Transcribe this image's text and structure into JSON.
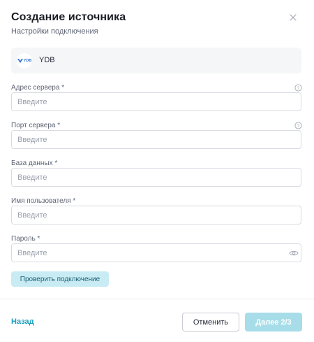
{
  "header": {
    "title": "Создание источника",
    "subtitle": "Настройки подключения",
    "close_icon": "close-icon"
  },
  "source": {
    "logo_text": "YDB",
    "name": "YDB"
  },
  "fields": [
    {
      "label": "Адрес сервера *",
      "placeholder": "Введите",
      "value": "",
      "has_help": true,
      "help_icon": "question-circle-icon"
    },
    {
      "label": "Порт сервера *",
      "placeholder": "Введите",
      "value": "",
      "has_help": true,
      "help_icon": "question-circle-icon"
    },
    {
      "label": "База данных *",
      "placeholder": "Введите",
      "value": "",
      "has_help": false
    },
    {
      "label": "Имя пользователя *",
      "placeholder": "Введите",
      "value": "",
      "has_help": false
    },
    {
      "label": "Пароль *",
      "placeholder": "Введите",
      "value": "",
      "has_help": false,
      "type": "password",
      "toggle_icon": "eye-icon"
    }
  ],
  "actions": {
    "check_label": "Проверить подключение",
    "back_label": "Назад",
    "cancel_label": "Отменить",
    "next_label": "Далее 2/3",
    "next_disabled": true
  },
  "colors": {
    "accent": "#1aa1be",
    "check_bg": "#c9ecf4",
    "next_disabled_bg": "#a7dde9",
    "card_bg": "#f5f6f8"
  }
}
